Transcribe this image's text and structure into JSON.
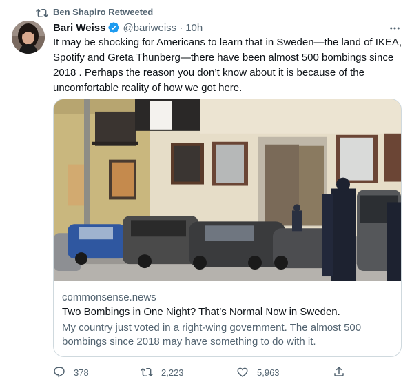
{
  "retweet_banner": {
    "label": "Ben Shapiro Retweeted",
    "icon": "retweet-icon"
  },
  "tweet": {
    "display_name": "Bari Weiss",
    "verified": true,
    "handle": "@bariweiss",
    "separator": "·",
    "time": "10h",
    "text": "It may be shocking for Americans to learn that in Sweden—the land of IKEA, Spotify and Greta Thunberg—there have been almost 500 bombings since 2018 . Perhaps the reason you don’t know about it is because of the uncomfortable reality of how we got here."
  },
  "card": {
    "domain": "commonsense.news",
    "title": "Two Bombings in One Night? That’s Normal Now in Sweden.",
    "description": "My country just voted in a right-wing government. The almost 500 bombings since 2018 may have something to do with it."
  },
  "actions": {
    "replies": "378",
    "retweets": "2,223",
    "likes": "5,963"
  },
  "colors": {
    "text_primary": "#0f1419",
    "text_secondary": "#536471",
    "verified_blue": "#1d9bf0",
    "border": "#cfd9de"
  }
}
